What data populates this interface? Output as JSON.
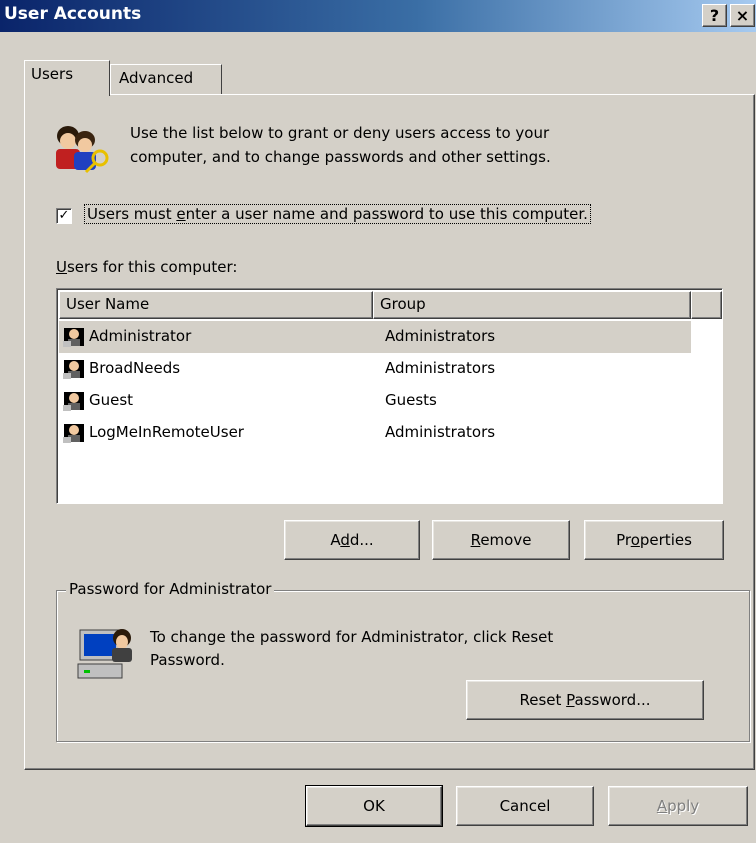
{
  "window": {
    "title": "User Accounts",
    "help_glyph": "?",
    "close_glyph": "×"
  },
  "tabs": [
    {
      "label": "Users",
      "active": true
    },
    {
      "label": "Advanced",
      "active": false
    }
  ],
  "intro": {
    "line1": "Use the list below to grant or deny users access to your",
    "line2": "computer, and to change passwords and other settings.",
    "icon": "users-keys-icon"
  },
  "require_login": {
    "checked": true,
    "check_glyph": "✓",
    "pre": "Users must ",
    "accel": "e",
    "post": "nter a user name and password to use this computer."
  },
  "users_section": {
    "label_accel": "U",
    "label_rest": "sers for this computer:"
  },
  "users_table": {
    "columns": [
      "User Name",
      "Group"
    ],
    "rows": [
      {
        "name": "Administrator",
        "group": "Administrators",
        "selected": true
      },
      {
        "name": "BroadNeeds",
        "group": "Administrators",
        "selected": false
      },
      {
        "name": "Guest",
        "group": "Guests",
        "selected": false
      },
      {
        "name": "LogMeInRemoteUser",
        "group": "Administrators",
        "selected": false
      }
    ]
  },
  "list_buttons": {
    "add": {
      "pre": "A",
      "accel": "d",
      "post": "d..."
    },
    "remove": {
      "pre": "",
      "accel": "R",
      "post": "emove"
    },
    "properties": {
      "pre": "Pr",
      "accel": "o",
      "post": "perties"
    }
  },
  "password_group": {
    "label": "Password for Administrator",
    "line1": "To change the password for Administrator, click Reset",
    "line2": "Password.",
    "reset": {
      "pre": "Reset ",
      "accel": "P",
      "post": "assword..."
    },
    "icon": "computer-user-icon"
  },
  "dialog_buttons": {
    "ok": "OK",
    "cancel": "Cancel",
    "apply": {
      "pre": "",
      "accel": "A",
      "post": "pply",
      "disabled": true
    }
  },
  "colors": {
    "titlebar_start": "#0a246a",
    "titlebar_end": "#a6caf0",
    "face": "#d4d0c8"
  }
}
